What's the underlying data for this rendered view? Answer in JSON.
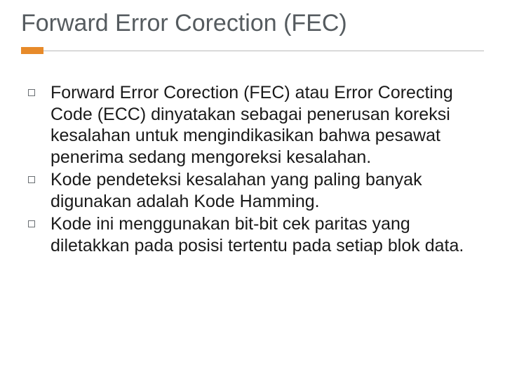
{
  "title": "Forward Error Corection (FEC)",
  "bullets": [
    "Forward Error Corection (FEC) atau Error Corecting Code (ECC) dinyatakan sebagai penerusan koreksi kesalahan untuk mengindikasikan bahwa pesawat penerima sedang mengoreksi kesalahan.",
    "Kode pendeteksi kesalahan yang paling banyak digunakan adalah Kode Hamming.",
    "Kode ini menggunakan bit-bit cek paritas yang diletakkan pada posisi tertentu pada setiap blok data."
  ]
}
